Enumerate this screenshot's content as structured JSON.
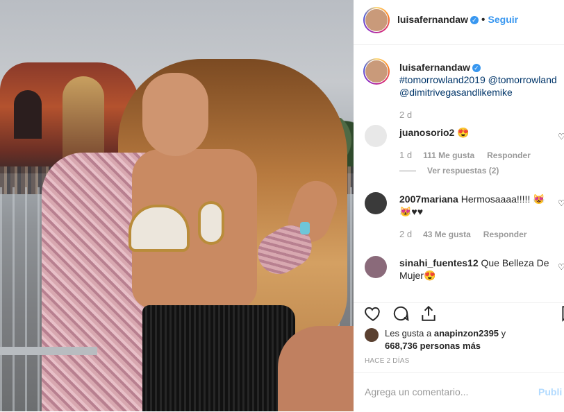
{
  "post": {
    "username": "luisafernandaw",
    "follow_label": "Seguir",
    "separator": "•"
  },
  "caption": {
    "username": "luisafernandaw",
    "line1": "#tomorrowland2019 @tomorrowland",
    "line2": "@dimitrivegasandlikemike",
    "time": "2 d"
  },
  "comments": [
    {
      "username": "juanosorio2",
      "text": "😍",
      "time": "1 d",
      "likes": "111 Me gusta",
      "reply": "Responder",
      "view_replies": "Ver respuestas (2)"
    },
    {
      "username": "2007mariana",
      "text": "Hermosaaaa!!!!! 😻",
      "text2": "😻♥♥",
      "time": "2 d",
      "likes": "43 Me gusta",
      "reply": "Responder"
    },
    {
      "username": "sinahi_fuentes12",
      "text": "Que Belleza De",
      "text2": "Mujer😍"
    }
  ],
  "likes_line": {
    "prefix": "Les gusta a",
    "user": "anapinzon2395",
    "conj": "y",
    "count": "668,736 personas más"
  },
  "timestamp": "HACE 2 DÍAS",
  "add_comment": {
    "placeholder": "Agrega un comentario...",
    "publish": "Publi"
  },
  "colors": {
    "accent": "#3897f0",
    "text": "#262626",
    "muted": "#999999"
  }
}
